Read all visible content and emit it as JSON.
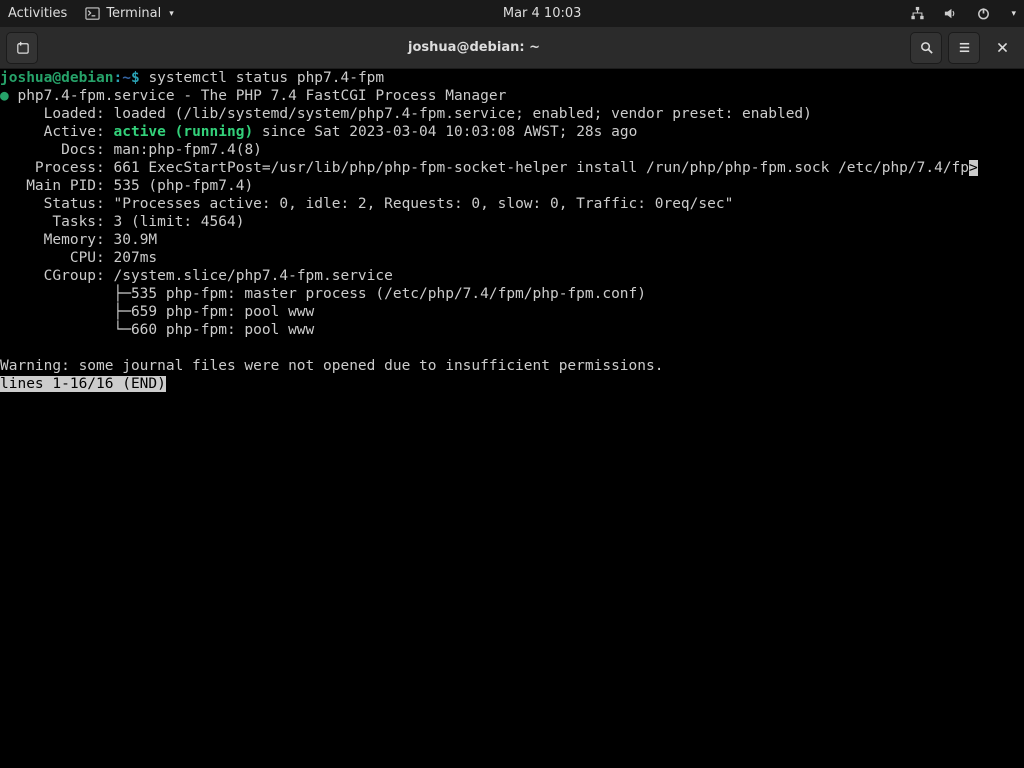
{
  "topbar": {
    "activities": "Activities",
    "app_name": "Terminal",
    "clock": "Mar 4  10:03"
  },
  "titlebar": {
    "title": "joshua@debian: ~"
  },
  "prompt": {
    "user": "joshua@debian",
    "sep": ":",
    "path": "~",
    "dollar": "$ ",
    "command": "systemctl status php7.4-fpm"
  },
  "status": {
    "bullet": "●",
    "service_line": " php7.4-fpm.service - The PHP 7.4 FastCGI Process Manager",
    "loaded_label": "     Loaded: ",
    "loaded_value": "loaded (/lib/systemd/system/php7.4-fpm.service; enabled; vendor preset: enabled)",
    "active_label": "     Active: ",
    "active_value": "active (running)",
    "active_since": " since Sat 2023-03-04 10:03:08 AWST; 28s ago",
    "docs_label": "       Docs: ",
    "docs_value": "man:php-fpm7.4(8)",
    "process_label": "    Process: ",
    "process_value": "661 ExecStartPost=/usr/lib/php/php-fpm-socket-helper install /run/php/php-fpm.sock /etc/php/7.4/fp",
    "process_trunc": ">",
    "mainpid_label": "   Main PID: ",
    "mainpid_value": "535 (php-fpm7.4)",
    "status_label": "     Status: ",
    "status_value": "\"Processes active: 0, idle: 2, Requests: 0, slow: 0, Traffic: 0req/sec\"",
    "tasks_label": "      Tasks: ",
    "tasks_value": "3 (limit: 4564)",
    "memory_label": "     Memory: ",
    "memory_value": "30.9M",
    "cpu_label": "        CPU: ",
    "cpu_value": "207ms",
    "cgroup_label": "     CGroup: ",
    "cgroup_value": "/system.slice/php7.4-fpm.service",
    "tree1": "             ├─535 php-fpm: master process (/etc/php/7.4/fpm/php-fpm.conf)",
    "tree2": "             ├─659 php-fpm: pool www",
    "tree3": "             └─660 php-fpm: pool www",
    "blank": "",
    "warning": "Warning: some journal files were not opened due to insufficient permissions.",
    "pager": "lines 1-16/16 (END)"
  }
}
